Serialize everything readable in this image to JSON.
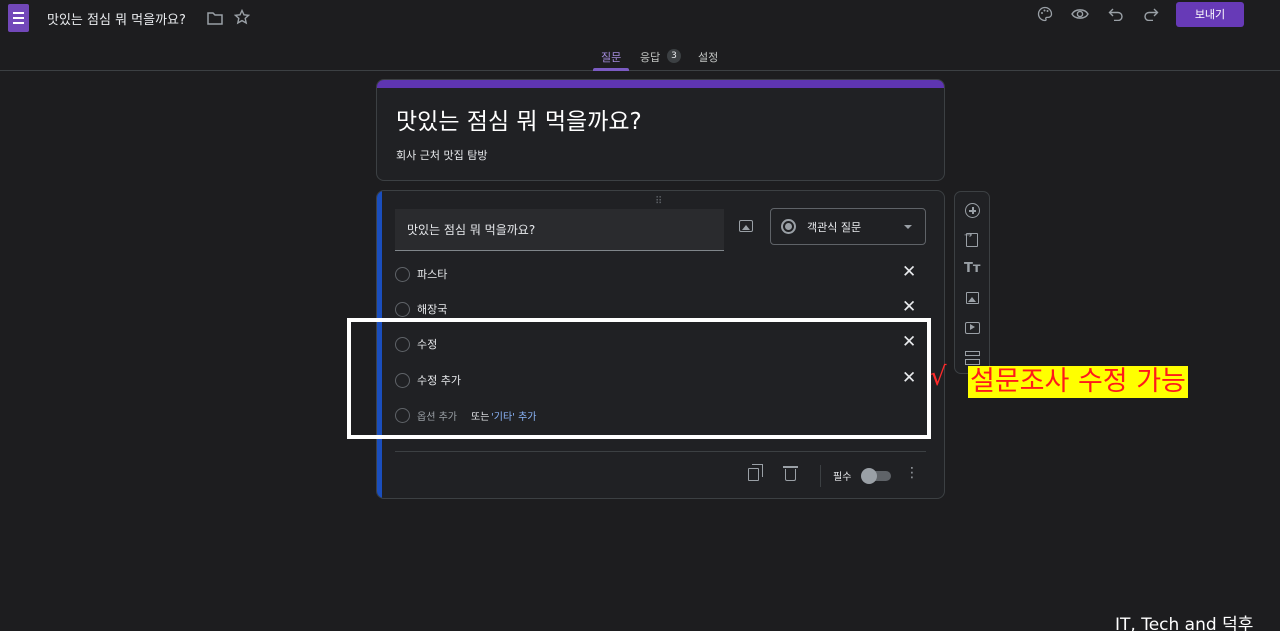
{
  "header": {
    "doc_title": "맛있는 점심 뭐 먹을까요?",
    "send_label": "보내기",
    "icons": [
      "forms-app-icon",
      "folder-icon",
      "star-icon",
      "palette-icon",
      "eye-icon",
      "undo-icon",
      "redo-icon"
    ]
  },
  "tabs": [
    {
      "label": "질문",
      "active": true
    },
    {
      "label": "응답",
      "badge": "3"
    },
    {
      "label": "설정"
    }
  ],
  "form": {
    "title": "맛있는 점심 뭐 먹을까요?",
    "description": "회사 근처 맛집 탐방"
  },
  "question": {
    "text": "맛있는 점심 뭐 먹을까요?",
    "type_label": "객관식 질문",
    "options": [
      "파스타",
      "해장국",
      "수정",
      "수정 추가"
    ],
    "add_option": {
      "prefix": "옵션 추가",
      "or": "또는",
      "other": "'기타' 추가"
    },
    "required_label": "필수",
    "required": false
  },
  "annotation": {
    "check": "√",
    "note": "설문조사 수정 가능",
    "box_color": "#ffffff",
    "note_bg": "#ffff00",
    "note_color": "#ff1a1a"
  },
  "watermark": "IT, Tech and 덕후",
  "colors": {
    "accent": "#673ab7",
    "question_bar": "#1a4ebd",
    "background": "#1d1d1f"
  }
}
